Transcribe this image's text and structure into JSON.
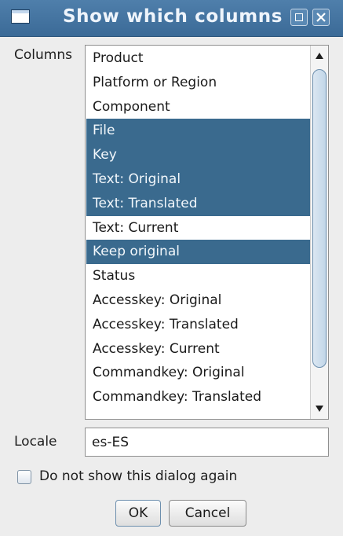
{
  "window": {
    "title": "Show which columns"
  },
  "columns": {
    "label": "Columns",
    "items": [
      {
        "label": "Product",
        "selected": false
      },
      {
        "label": "Platform or Region",
        "selected": false
      },
      {
        "label": "Component",
        "selected": false
      },
      {
        "label": "File",
        "selected": true
      },
      {
        "label": "Key",
        "selected": true
      },
      {
        "label": "Text: Original",
        "selected": true
      },
      {
        "label": "Text: Translated",
        "selected": true
      },
      {
        "label": "Text: Current",
        "selected": false
      },
      {
        "label": "Keep original",
        "selected": true
      },
      {
        "label": "Status",
        "selected": false
      },
      {
        "label": "Accesskey: Original",
        "selected": false
      },
      {
        "label": "Accesskey: Translated",
        "selected": false
      },
      {
        "label": "Accesskey: Current",
        "selected": false
      },
      {
        "label": "Commandkey: Original",
        "selected": false
      },
      {
        "label": "Commandkey: Translated",
        "selected": false
      }
    ]
  },
  "locale": {
    "label": "Locale",
    "value": "es-ES"
  },
  "dont_show": {
    "label": "Do not show this dialog again",
    "checked": false
  },
  "buttons": {
    "ok": "OK",
    "cancel": "Cancel"
  },
  "colors": {
    "selection": "#3a6a8e",
    "titlebar": "#4a79a6"
  }
}
